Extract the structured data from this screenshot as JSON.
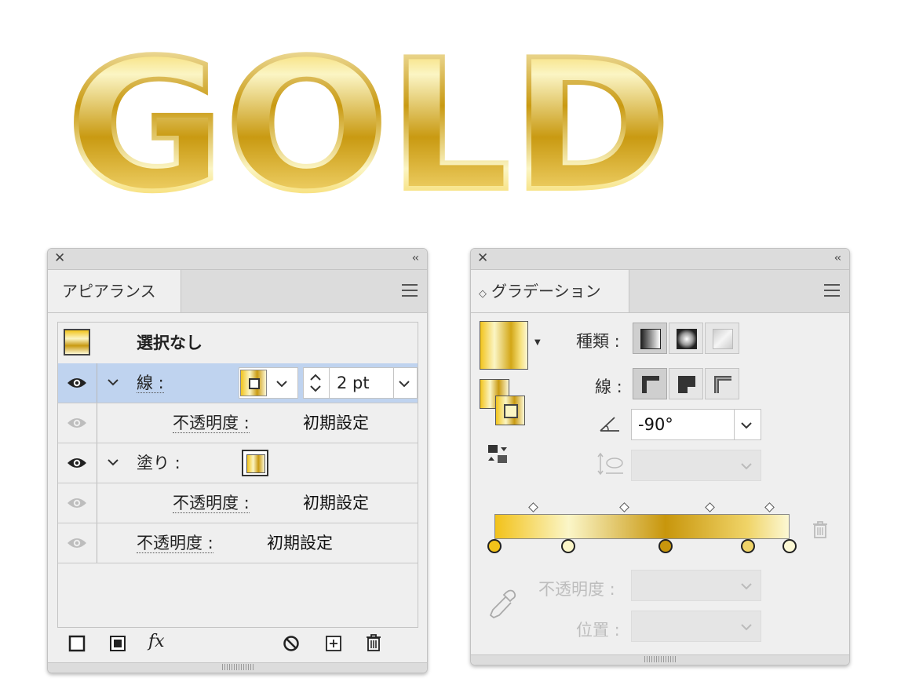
{
  "artwork": {
    "text": "GOLD"
  },
  "colors": {
    "gold_dark": "#c9960a",
    "gold_mid": "#e6c21a",
    "gold_light": "#fbf3b8",
    "selection": "#bfd3ef"
  },
  "appearance_panel": {
    "close_icon": "close-icon",
    "collapse_label": "‹‹",
    "tab_label": "アピアランス",
    "header_label": "選択なし",
    "stroke_row": {
      "label": "線 :",
      "weight": "2 pt"
    },
    "stroke_opacity": {
      "label": "不透明度 :",
      "value": "初期設定"
    },
    "fill_row": {
      "label": "塗り :"
    },
    "fill_opacity": {
      "label": "不透明度 :",
      "value": "初期設定"
    },
    "object_opacity": {
      "label": "不透明度 :",
      "value": "初期設定"
    },
    "toolbar": [
      "add-new-stroke-icon",
      "add-new-fill-icon",
      "fx-icon",
      "clear-appearance-icon",
      "duplicate-item-icon",
      "delete-item-icon"
    ],
    "fx_label": "fx"
  },
  "gradient_panel": {
    "collapse_label": "‹‹",
    "tab_label": "グラデーション",
    "type_label": "種類 :",
    "stroke_label": "線 :",
    "angle_value": "-90°",
    "opacity_label": "不透明度 :",
    "position_label": "位置 :",
    "stops": [
      {
        "position": 0,
        "color": "#f2c21a"
      },
      {
        "position": 25,
        "color": "#fbf6c8"
      },
      {
        "position": 58,
        "color": "#c8960c"
      },
      {
        "position": 86,
        "color": "#f0d468"
      },
      {
        "position": 100,
        "color": "#fcf8d4"
      }
    ],
    "midpoints": [
      13,
      44,
      73,
      93
    ]
  }
}
